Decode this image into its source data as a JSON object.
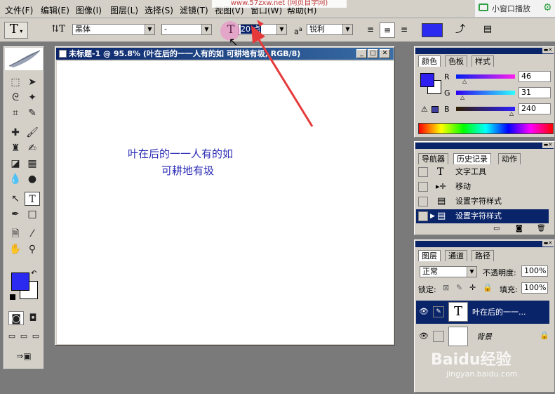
{
  "menu": [
    "文件(F)",
    "编辑(E)",
    "图像(I)",
    "图层(L)",
    "选择(S)",
    "滤镜(T)",
    "视图(V)",
    "窗口(W)",
    "帮助(H)"
  ],
  "url_overlay": "www.57zxw.net (网页自学网)",
  "topright": {
    "mini_window_label": "小窗口播放"
  },
  "options": {
    "tool_glyph": "T",
    "font_family": "黑体",
    "font_style": "-",
    "font_size": "20 点",
    "aa_label": "a",
    "antialias": "锐利",
    "color": "#2a2af0"
  },
  "document": {
    "title": "未标题-1 @ 95.8% (叶在后的一一人有的如 可耕地有圾, RGB/8)",
    "text_line1": "叶在后的一一人有的如",
    "text_line2": "可耕地有圾",
    "text_color": "#2b2bb5"
  },
  "color_panel": {
    "tabs": [
      "颜色",
      "色板",
      "样式"
    ],
    "r_label": "R",
    "g_label": "G",
    "b_label": "B",
    "r_value": "46",
    "g_value": "31",
    "b_value": "240",
    "swatch": "#2e1ff0"
  },
  "history_panel": {
    "tabs": [
      "导航器",
      "历史记录",
      "动作"
    ],
    "items": [
      "文字工具",
      "移动",
      "设置字符样式",
      "设置字符样式"
    ]
  },
  "layers_panel": {
    "tabs": [
      "图层",
      "通道",
      "路径"
    ],
    "blend_mode": "正常",
    "opacity_label": "不透明度:",
    "opacity_value": "100%",
    "lock_label": "锁定:",
    "fill_label": "填充:",
    "fill_value": "100%",
    "layers": [
      {
        "name": "叶在后的一一...",
        "thumb": "T"
      },
      {
        "name": "背景"
      }
    ]
  },
  "watermark": {
    "brand": "Baidu经验",
    "url": "jingyan.baidu.com"
  }
}
